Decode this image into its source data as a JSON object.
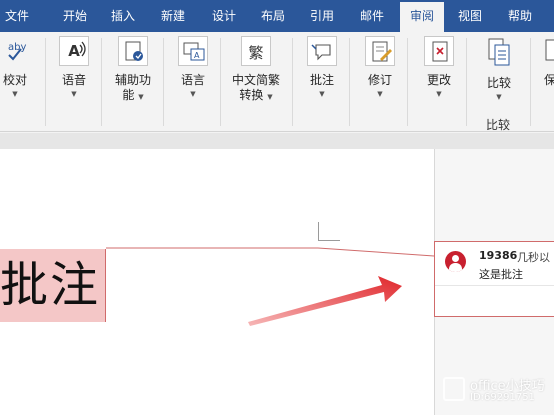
{
  "tabs": [
    {
      "label": "文件"
    },
    {
      "label": "开始"
    },
    {
      "label": "插入"
    },
    {
      "label": "新建"
    },
    {
      "label": "设计"
    },
    {
      "label": "布局"
    },
    {
      "label": "引用"
    },
    {
      "label": "邮件"
    },
    {
      "label": "审阅",
      "active": true
    },
    {
      "label": "视图"
    },
    {
      "label": "帮助"
    }
  ],
  "ribbon": {
    "proofing": {
      "label": "校对"
    },
    "speech": {
      "label": "语音"
    },
    "accessibility": {
      "label_line1": "辅助功",
      "label_line2": "能"
    },
    "language": {
      "label": "语言"
    },
    "chinese_conversion": {
      "label_line1": "中文简繁",
      "label_line2": "转换"
    },
    "comments": {
      "label": "批注"
    },
    "tracking": {
      "label": "修订"
    },
    "changes": {
      "label": "更改"
    },
    "compare": {
      "label": "比较",
      "group_label": "比较"
    },
    "protect": {
      "label": "保"
    }
  },
  "icons": {
    "speech_glyph": "A",
    "chinese_glyph": "繁"
  },
  "document": {
    "highlighted_text": "批注"
  },
  "comment": {
    "author": "19386",
    "time": "几秒以",
    "text": "这是批注"
  },
  "watermark": {
    "title": "office小技巧",
    "id": "ID:69291751"
  },
  "colors": {
    "ribbon_blue": "#2b579a",
    "comment_accent": "#c8202f",
    "highlight": "#f4c7c7",
    "arrow_red": "#e0262b"
  }
}
